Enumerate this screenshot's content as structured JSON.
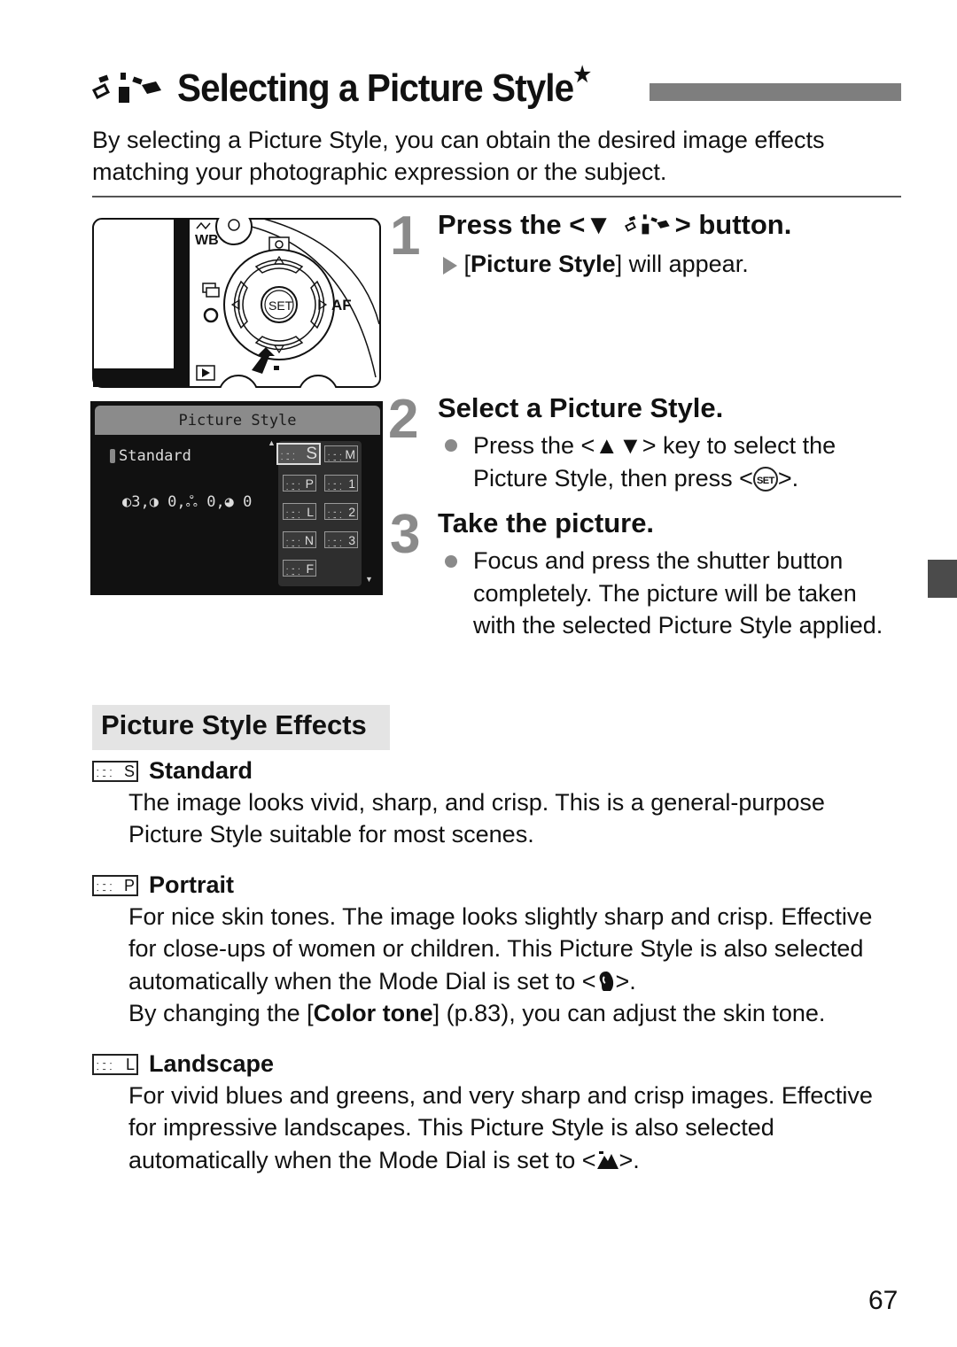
{
  "header": {
    "icon": "picture-style-icon",
    "title": "Selecting a Picture Style",
    "title_mark": "★",
    "intro": "By selecting a Picture Style, you can obtain the desired image effects matching your photographic expression or the subject."
  },
  "camera_illustration": {
    "labels": {
      "wb": "WB",
      "set": "SET",
      "af": "AF"
    }
  },
  "lcd": {
    "header": "Picture Style",
    "current_style": "Standard",
    "params": "◐3,◑ 0,ஃ 0,◕ 0",
    "styles": [
      {
        "code": "S",
        "selected": true
      },
      {
        "code": "M",
        "selected": false
      },
      {
        "code": "P",
        "selected": false
      },
      {
        "code": "1",
        "selected": false
      },
      {
        "code": "L",
        "selected": false
      },
      {
        "code": "2",
        "selected": false
      },
      {
        "code": "N",
        "selected": false
      },
      {
        "code": "3",
        "selected": false
      },
      {
        "code": "F",
        "selected": false
      }
    ],
    "chip_icon": "⸬⸬"
  },
  "steps": [
    {
      "number": "1",
      "title_pre": "Press the <",
      "title_key": "▼",
      "title_post": "> button.",
      "result_open": "[",
      "result_bold": "Picture Style",
      "result_rest": "] will appear."
    },
    {
      "number": "2",
      "title": "Select a Picture Style.",
      "body_pre": "Press the <",
      "body_key": "▲▼",
      "body_mid": "> key to select the Picture Style, then press <",
      "body_set": "SET",
      "body_post": ">."
    },
    {
      "number": "3",
      "title": "Take the picture.",
      "body": "Focus and press the shutter button completely. The picture will be taken with the selected Picture Style applied."
    }
  ],
  "effects": {
    "heading": "Picture Style Effects",
    "items": [
      {
        "code": "S",
        "name": "Standard",
        "body": "The image looks vivid, sharp, and crisp. This is a general-purpose Picture Style suitable for most scenes."
      },
      {
        "code": "P",
        "name": "Portrait",
        "body_1": "For nice skin tones. The image looks slightly sharp and crisp. Effective for close-ups of women or children. This Picture Style is also selected automatically when the Mode Dial is set to <",
        "mode_icon": "portrait-mode-icon",
        "body_2": ">.",
        "body_3_pre": "By changing the [",
        "body_3_bold": "Color tone",
        "body_3_post": "] (p.83), you can adjust the skin tone."
      },
      {
        "code": "L",
        "name": "Landscape",
        "body_1": "For vivid blues and greens, and very sharp and crisp images. Effective for impressive landscapes. This Picture Style is also selected automatically when the Mode Dial is set to <",
        "mode_icon": "landscape-mode-icon",
        "body_2": ">."
      }
    ]
  },
  "page_number": "67"
}
